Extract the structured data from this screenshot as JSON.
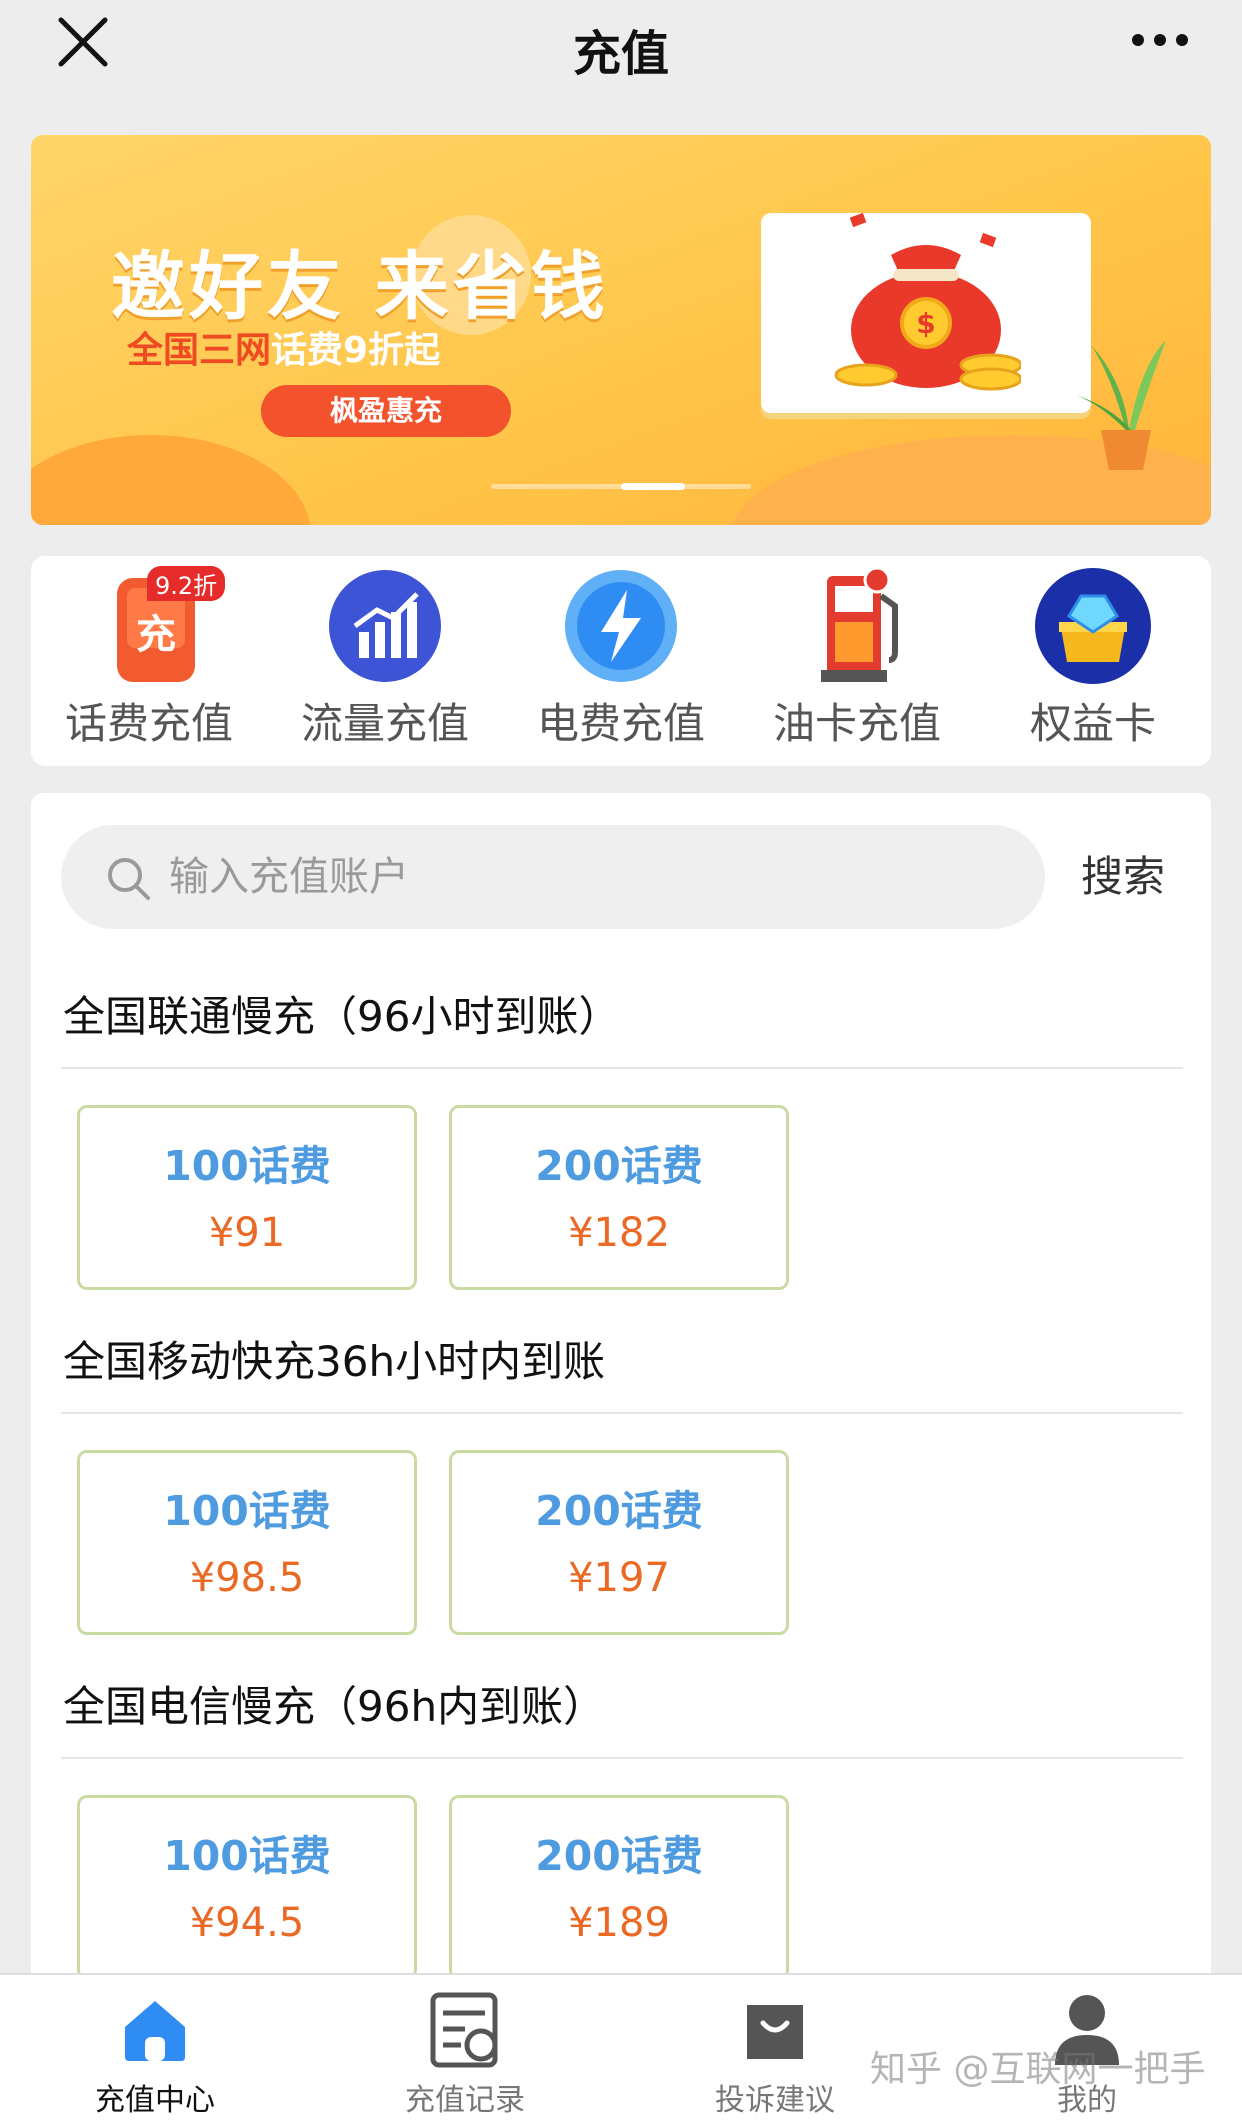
{
  "header": {
    "title": "充值"
  },
  "banner": {
    "headline": "邀好友 来省钱",
    "sub_red": "全国三网",
    "sub_white": "话费9折起",
    "button_label": "枫盈惠充"
  },
  "categories": [
    {
      "label": "话费充值",
      "badge": "9.2折",
      "icon_text": "充",
      "icon": "phone-recharge-icon"
    },
    {
      "label": "流量充值",
      "icon": "data-chart-icon"
    },
    {
      "label": "电费充值",
      "icon": "lightning-icon"
    },
    {
      "label": "油卡充值",
      "icon": "fuel-pump-icon"
    },
    {
      "label": "权益卡",
      "icon": "treasure-chest-icon"
    }
  ],
  "search": {
    "placeholder": "输入充值账户",
    "button_label": "搜索"
  },
  "sections": [
    {
      "title": "全国联通慢充（96小时到账）",
      "products": [
        {
          "name": "100话费",
          "price": "¥91"
        },
        {
          "name": "200话费",
          "price": "¥182"
        }
      ]
    },
    {
      "title": "全国移动快充36h小时内到账",
      "products": [
        {
          "name": "100话费",
          "price": "¥98.5"
        },
        {
          "name": "200话费",
          "price": "¥197"
        }
      ]
    },
    {
      "title": "全国电信慢充（96h内到账）",
      "products": [
        {
          "name": "100话费",
          "price": "¥94.5"
        },
        {
          "name": "200话费",
          "price": "¥189"
        }
      ]
    }
  ],
  "bottom_nav": [
    {
      "label": "充值中心",
      "active": true
    },
    {
      "label": "充值记录"
    },
    {
      "label": "投诉建议"
    },
    {
      "label": "我的"
    }
  ],
  "watermark": "知乎 @互联网一把手",
  "colors": {
    "accent_blue": "#2f8cf3",
    "price_orange": "#ea6a25",
    "product_border": "#c9dba2"
  }
}
